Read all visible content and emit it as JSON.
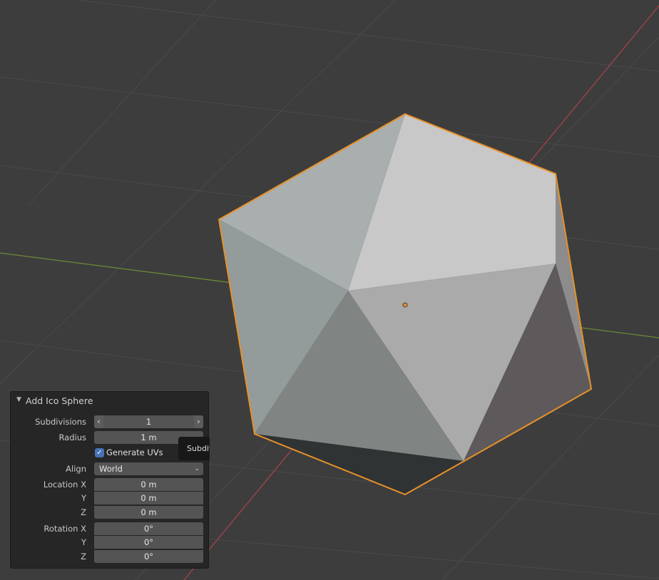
{
  "colors": {
    "background": "#3d3d3d",
    "grid": "#4a4a4a",
    "axis_x": "#a4434b",
    "axis_y": "#6b8a36",
    "selection_outline": "#e8912a",
    "panel_bg": "#262626",
    "field_bg": "#545454",
    "checkbox_accent": "#4772b3"
  },
  "panel": {
    "title": "Add Ico Sphere",
    "collapse_icon": "triangle-down-icon",
    "subdivisions": {
      "label": "Subdivisions",
      "value": "1",
      "left_arrow": "‹",
      "right_arrow": "›"
    },
    "radius": {
      "label": "Radius",
      "value": "1 m"
    },
    "generate_uvs": {
      "label": "Generate UVs",
      "checked": true,
      "check": "✓"
    },
    "align": {
      "label": "Align",
      "value": "World",
      "chevron": "⌄"
    },
    "location": {
      "label": "Location X",
      "y_label": "Y",
      "z_label": "Z",
      "x": "0 m",
      "y": "0 m",
      "z": "0 m"
    },
    "rotation": {
      "label": "Rotation X",
      "y_label": "Y",
      "z_label": "Z",
      "x": "0°",
      "y": "0°",
      "z": "0°"
    }
  },
  "tooltip": {
    "text": "Subdivisions"
  }
}
